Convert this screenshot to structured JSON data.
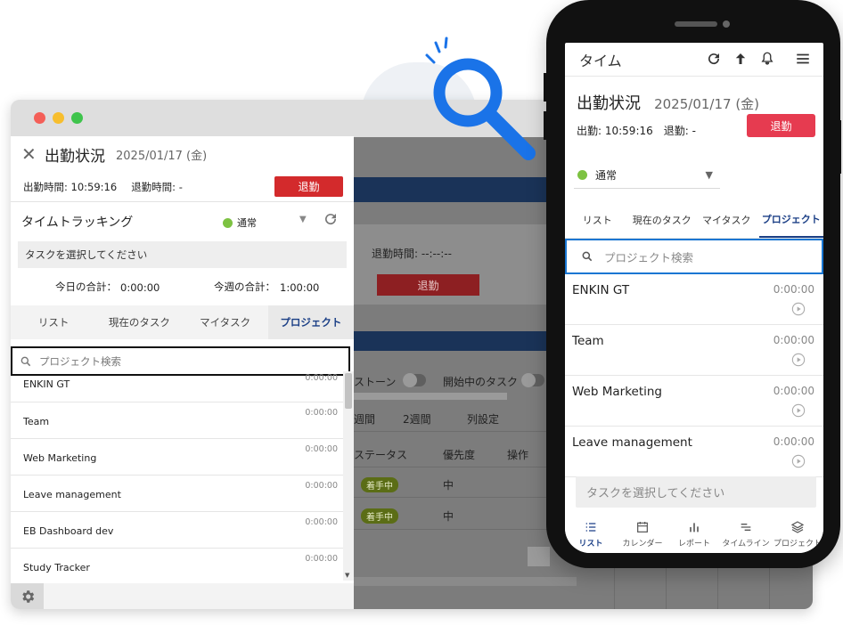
{
  "left_panel": {
    "title": "出勤状況",
    "date": "2025/01/17 (金)",
    "clock_in": "出勤時間: 10:59:16",
    "clock_out": "退勤時間: -",
    "leave_button": "退勤",
    "tracking_title": "タイムトラッキング",
    "status": "通常",
    "task_placeholder": "タスクを選択してください",
    "today_label": "今日の合計：",
    "today_value": "0:00:00",
    "week_label": "今週の合計：",
    "week_value": "1:00:00",
    "tabs": [
      "リスト",
      "現在のタスク",
      "マイタスク",
      "プロジェクト"
    ],
    "search_placeholder": "プロジェクト検索",
    "projects": [
      {
        "name": "ENKIN GT",
        "time": "0:00:00"
      },
      {
        "name": "Team",
        "time": "0:00:00"
      },
      {
        "name": "Web Marketing",
        "time": "0:00:00"
      },
      {
        "name": "Leave management",
        "time": "0:00:00"
      },
      {
        "name": "EB Dashboard dev",
        "time": "0:00:00"
      },
      {
        "name": "Study Tracker",
        "time": "0:00:00"
      }
    ]
  },
  "background_app": {
    "clock_out": "退勤時間: --:--:--",
    "leave_button": "退勤",
    "milestone": "ストーン",
    "started_task": "開始中のタスク",
    "week_tab": "週間",
    "two_week_tab": "2週間",
    "column_setting": "列設定",
    "col_status": "ステータス",
    "col_priority": "優先度",
    "col_action": "操作",
    "tag": "着手中",
    "priority": "中"
  },
  "phone": {
    "app_title": "タイム",
    "title": "出勤状況",
    "date": "2025/01/17 (金)",
    "times": "出勤: 10:59:16　退勤: -",
    "leave_button": "退勤",
    "status": "通常",
    "tabs": [
      "リスト",
      "現在のタスク",
      "マイタスク",
      "プロジェクト"
    ],
    "search_placeholder": "プロジェクト検索",
    "projects": [
      {
        "name": "ENKIN GT",
        "time": "0:00:00"
      },
      {
        "name": "Team",
        "time": "0:00:00"
      },
      {
        "name": "Web Marketing",
        "time": "0:00:00"
      },
      {
        "name": "Leave management",
        "time": "0:00:00"
      }
    ],
    "task_placeholder": "タスクを選択してください",
    "nav": [
      "リスト",
      "カレンダー",
      "レポート",
      "タイムライン",
      "プロジェクト"
    ]
  },
  "colors": {
    "accent": "#1b3f86",
    "leave": "#d32a2c",
    "phone_leave": "#e63b50",
    "status_dot": "#7dc242",
    "search_focus": "#1976d2",
    "magnifier": "#1a73e8"
  }
}
